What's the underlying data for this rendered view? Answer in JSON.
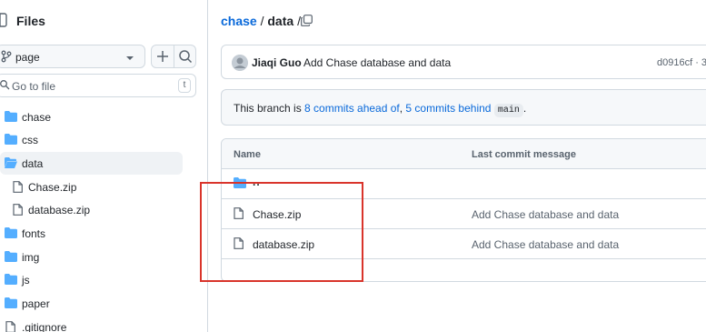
{
  "sidebar": {
    "title": "Files",
    "branch": "page",
    "goto_placeholder": "Go to file",
    "goto_shortcut": "t",
    "items": [
      {
        "label": "chase",
        "type": "folder"
      },
      {
        "label": "css",
        "type": "folder"
      },
      {
        "label": "data",
        "type": "folder-open"
      },
      {
        "label": "Chase.zip",
        "type": "file"
      },
      {
        "label": "database.zip",
        "type": "file"
      },
      {
        "label": "fonts",
        "type": "folder"
      },
      {
        "label": "img",
        "type": "folder"
      },
      {
        "label": "js",
        "type": "folder"
      },
      {
        "label": "paper",
        "type": "folder"
      },
      {
        "label": ".gitignore",
        "type": "file"
      }
    ]
  },
  "breadcrumb": {
    "repo": "chase",
    "sep1": "/",
    "folder": "data",
    "sep2": "/"
  },
  "commit": {
    "author": "Jiaqi Guo",
    "message": "Add Chase database and data",
    "sha": "d0916cf · 3"
  },
  "branch_status": {
    "prefix": "This branch is ",
    "ahead": "8 commits ahead of",
    "comma": ", ",
    "behind": "5 commits behind",
    "base": "main",
    "suffix": "."
  },
  "table": {
    "col_name": "Name",
    "col_message": "Last commit message",
    "parent": "..",
    "rows": [
      {
        "name": "Chase.zip",
        "message": "Add Chase database and data"
      },
      {
        "name": "database.zip",
        "message": "Add Chase database and data"
      }
    ]
  },
  "colors": {
    "accent": "#0969da",
    "folder": "#54aeff",
    "highlight": "#d9342b"
  }
}
